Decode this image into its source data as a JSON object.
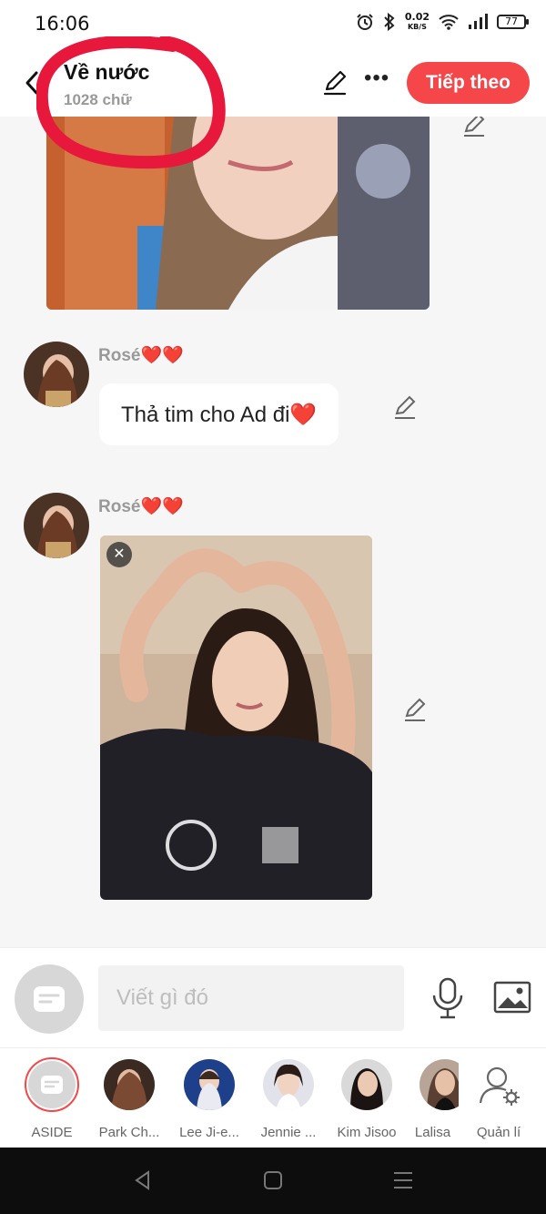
{
  "status": {
    "time": "16:06",
    "net_speed": "0.02",
    "net_unit": "KB/S",
    "battery": "77"
  },
  "header": {
    "title": "Về nước",
    "subtitle": "1028 chữ",
    "next_label": "Tiếp theo"
  },
  "messages": [
    {
      "sender": "Rosé❤️❤️",
      "text": "Thả tim cho Ad đi❤️"
    },
    {
      "sender": "Rosé❤️❤️",
      "type": "image"
    }
  ],
  "composer": {
    "placeholder": "Viết gì đó"
  },
  "characters": [
    {
      "name": "ASIDE"
    },
    {
      "name": "Park Ch..."
    },
    {
      "name": "Lee Ji-e..."
    },
    {
      "name": "Jennie ..."
    },
    {
      "name": "Kim Jisoo"
    },
    {
      "name": "Lalisa"
    },
    {
      "name": "Quản lí"
    }
  ],
  "icons": [
    "back-arrow-icon",
    "pencil-icon",
    "more-icon",
    "close-icon",
    "message-icon",
    "microphone-icon",
    "image-icon",
    "user-settings-icon",
    "nav-back-icon",
    "nav-home-icon",
    "nav-menu-icon"
  ],
  "colors": {
    "accent": "#f5474a",
    "annotation": "#e8173c",
    "background": "#f6f6f6"
  }
}
